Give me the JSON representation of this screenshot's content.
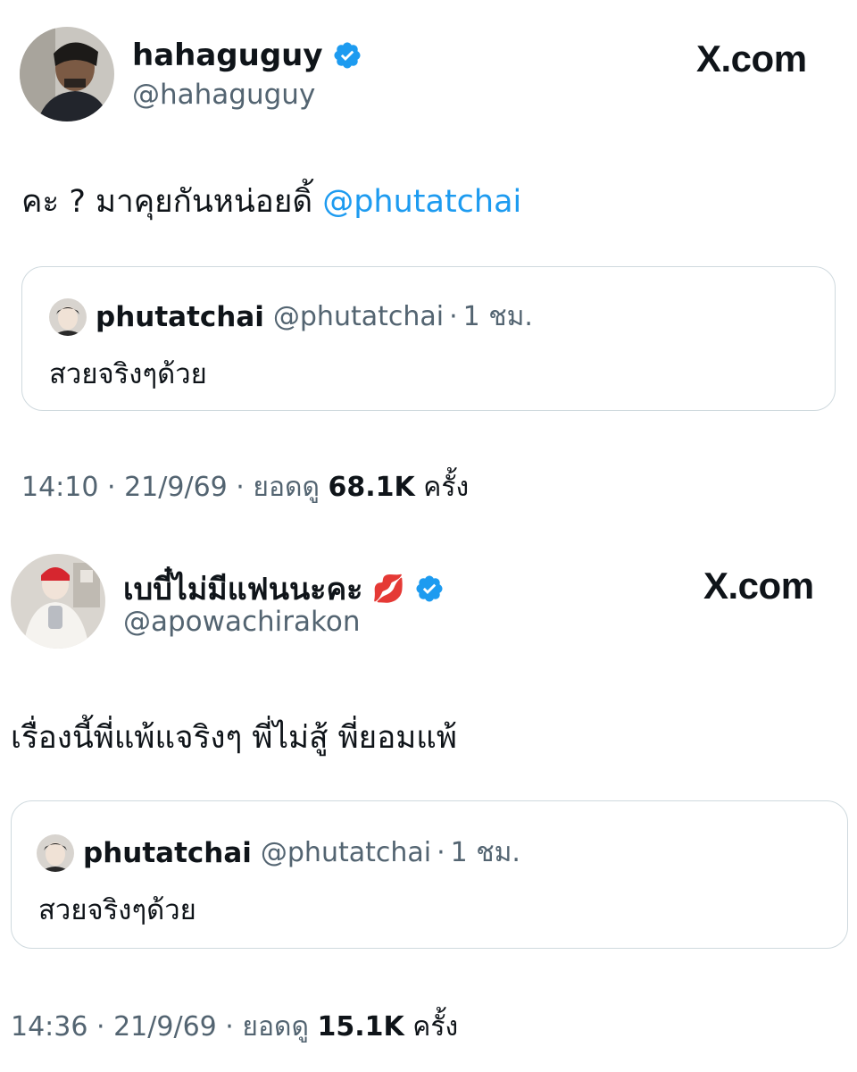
{
  "tweets": [
    {
      "display_name": "hahaguguy",
      "handle": "@hahaguguy",
      "verified": true,
      "site_logo": "X.com",
      "text_before_mention": "คะ ? มาคุยกันหน่อยดิ้ ",
      "mention": "@phutatchai",
      "quote": {
        "display_name": "phutatchai",
        "handle": "@phutatchai",
        "separator": "·",
        "time": "1 ชม.",
        "text": "สวยจริงๆด้วย"
      },
      "time": "14:10",
      "date": "21/9/69",
      "views_label": "ยอดดู",
      "views": "68.1K",
      "views_suffix": "ครั้ง"
    },
    {
      "display_name": "เบบี๋ไม่มีแฟนนะคะ",
      "name_emoji": "💋",
      "handle": "@apowachirakon",
      "verified": true,
      "site_logo": "X.com",
      "text": "เรื่องนี้พี่แพ้แจริงๆ พี่ไม่สู้  พี่ยอมแพ้",
      "quote": {
        "display_name": "phutatchai",
        "handle": "@phutatchai",
        "separator": "·",
        "time": "1 ชม.",
        "text": "สวยจริงๆด้วย"
      },
      "time": "14:36",
      "date": "21/9/69",
      "views_label": "ยอดดู",
      "views": "15.1K",
      "views_suffix": "ครั้ง"
    }
  ],
  "icons": {
    "verified": "verified-badge-icon",
    "lips": "kiss-lips-icon"
  },
  "colors": {
    "verified": "#1d9bf0",
    "mention": "#1d9bf0",
    "secondary_text": "#536471",
    "primary_text": "#0f1419",
    "border": "#cfd9de"
  }
}
